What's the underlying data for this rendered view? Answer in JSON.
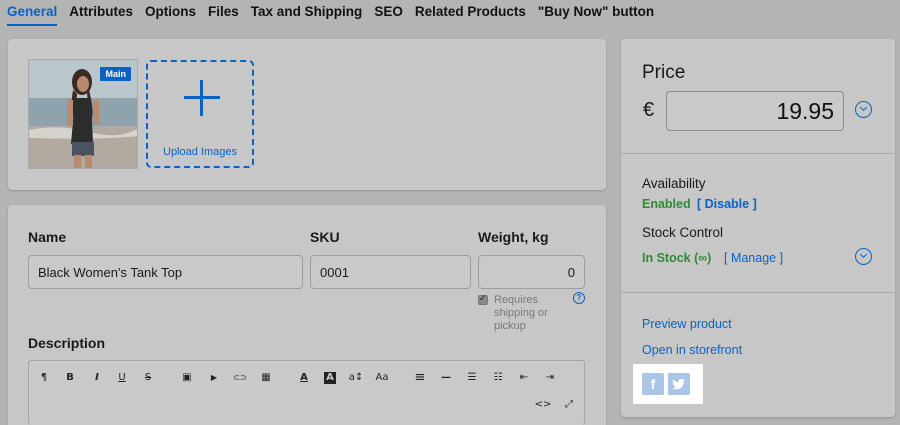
{
  "tabs": [
    {
      "label": "General",
      "active": true
    },
    {
      "label": "Attributes"
    },
    {
      "label": "Options"
    },
    {
      "label": "Files"
    },
    {
      "label": "Tax and Shipping"
    },
    {
      "label": "SEO"
    },
    {
      "label": "Related Products"
    },
    {
      "label": "\"Buy Now\" button"
    }
  ],
  "images": {
    "main_badge": "Main",
    "upload_label": "Upload Images"
  },
  "product": {
    "name_label": "Name",
    "name_value": "Black Women's Tank Top",
    "sku_label": "SKU",
    "sku_value": "0001",
    "weight_label": "Weight, kg",
    "weight_value": "0",
    "requires_shipping_label": "Requires shipping or pickup",
    "requires_shipping_checked": true,
    "description_label": "Description"
  },
  "editor_toolbar": {
    "paragraph": "¶",
    "bold": "B",
    "italic": "I",
    "underline": "U",
    "strike": "S",
    "image": "▣",
    "video": "▶",
    "link": "⊂⊃",
    "table": "▦",
    "text_color": "A",
    "bg_color": "A",
    "font_size": "a↕",
    "font_family": "Aa",
    "align": "≡",
    "hr": "—",
    "ul": "☰",
    "ol": "☷",
    "outdent": "⇤",
    "indent": "⇥",
    "code": "<>",
    "fullscreen": "⤢"
  },
  "price": {
    "title": "Price",
    "currency": "€",
    "value": "19.95"
  },
  "availability": {
    "label": "Availability",
    "status": "Enabled",
    "action": "[ Disable ]"
  },
  "stock": {
    "label": "Stock Control",
    "status": "In Stock (∞)",
    "action": "[ Manage ]"
  },
  "links": {
    "preview": "Preview product",
    "storefront": "Open in storefront"
  },
  "social": {
    "facebook": "f",
    "twitter": "t"
  },
  "colors": {
    "accent": "#0a63c4",
    "success": "#2f8a36"
  }
}
